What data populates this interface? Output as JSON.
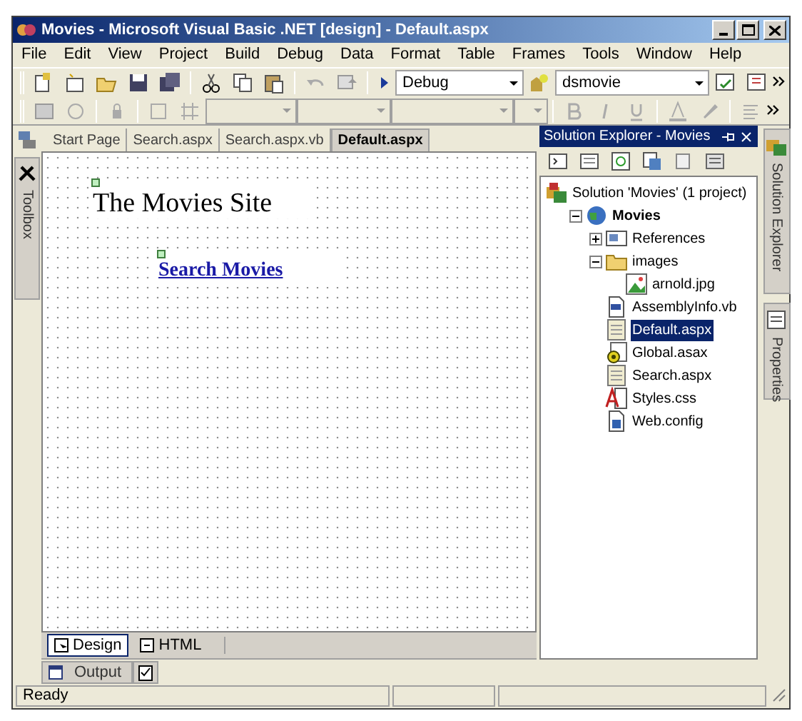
{
  "window": {
    "title": "Movies - Microsoft Visual Basic .NET [design] - Default.aspx"
  },
  "menu": [
    "File",
    "Edit",
    "View",
    "Project",
    "Build",
    "Debug",
    "Data",
    "Format",
    "Table",
    "Frames",
    "Tools",
    "Window",
    "Help"
  ],
  "toolbar": {
    "configuration": "Debug",
    "project": "dsmovie"
  },
  "document_tabs": [
    {
      "label": "Start Page",
      "selected": false
    },
    {
      "label": "Search.aspx",
      "selected": false
    },
    {
      "label": "Search.aspx.vb",
      "selected": false
    },
    {
      "label": "Default.aspx",
      "selected": true
    }
  ],
  "toolbox": {
    "label": "Toolbox"
  },
  "page": {
    "heading": "The Movies Site",
    "link": "Search Movies"
  },
  "view_tabs": [
    {
      "label": "Design",
      "selected": true
    },
    {
      "label": "HTML",
      "selected": false
    }
  ],
  "solution_explorer": {
    "title": "Solution Explorer - Movies",
    "tree": [
      {
        "label": "Solution 'Movies' (1 project)",
        "kind": "solution",
        "selected": false,
        "children": [
          {
            "label": "Movies",
            "kind": "project",
            "selected": false,
            "expanded": true,
            "children": [
              {
                "label": "References",
                "kind": "references",
                "selected": false,
                "expanded": false
              },
              {
                "label": "images",
                "kind": "folder",
                "selected": false,
                "expanded": true,
                "children": [
                  {
                    "label": "arnold.jpg",
                    "kind": "image",
                    "selected": false
                  }
                ]
              },
              {
                "label": "AssemblyInfo.vb",
                "kind": "vb",
                "selected": false
              },
              {
                "label": "Default.aspx",
                "kind": "aspx",
                "selected": true
              },
              {
                "label": "Global.asax",
                "kind": "asax",
                "selected": false
              },
              {
                "label": "Search.aspx",
                "kind": "aspx",
                "selected": false
              },
              {
                "label": "Styles.css",
                "kind": "css",
                "selected": false
              },
              {
                "label": "Web.config",
                "kind": "config",
                "selected": false
              }
            ]
          }
        ]
      }
    ]
  },
  "side_tabs": [
    "Solution Explorer",
    "Properties"
  ],
  "bottom_tabs": [
    "Output"
  ],
  "status_bar": {
    "text": "Ready"
  }
}
